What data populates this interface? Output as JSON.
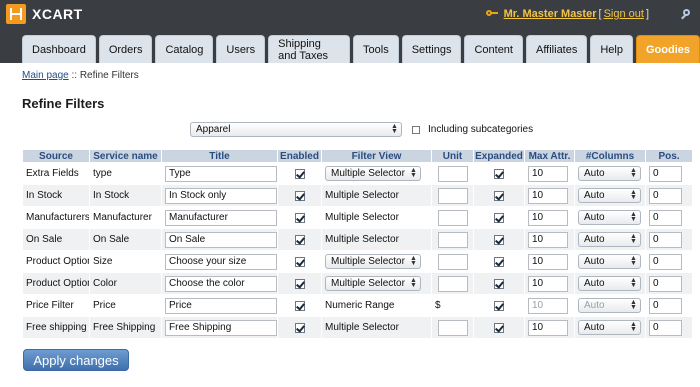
{
  "brand": {
    "name": "XCART"
  },
  "user": {
    "name": "Mr. Master Master",
    "bracket_open": "[",
    "signout": "Sign out",
    "bracket_close": "]"
  },
  "tabs": [
    {
      "label": "Dashboard"
    },
    {
      "label": "Orders"
    },
    {
      "label": "Catalog"
    },
    {
      "label": "Users"
    },
    {
      "label": "Shipping and Taxes"
    },
    {
      "label": "Tools"
    },
    {
      "label": "Settings"
    },
    {
      "label": "Content"
    },
    {
      "label": "Affiliates"
    },
    {
      "label": "Help"
    },
    {
      "label": "Goodies",
      "active": true
    }
  ],
  "breadcrumb": {
    "home": "Main page",
    "sep": " :: ",
    "current": "Refine Filters"
  },
  "page_title": "Refine Filters",
  "category": {
    "selected": "Apparel",
    "include_sub_label": "Including subcategories",
    "include_sub_checked": false
  },
  "table": {
    "headers": [
      "Source",
      "Service name",
      "Title",
      "Enabled",
      "Filter View",
      "Unit",
      "Expanded",
      "Max Attr.",
      "#Columns",
      "Pos."
    ],
    "rows": [
      {
        "source": "Extra Fields",
        "service": "type",
        "title": "Type",
        "enabled": true,
        "filter_view": "Multiple Selector",
        "filter_view_select": true,
        "unit": "",
        "unit_input": true,
        "expanded": true,
        "max": "10",
        "max_dim": false,
        "columns": "Auto",
        "columns_dim": false,
        "pos": "0"
      },
      {
        "source": "In Stock",
        "service": "In Stock",
        "title": "In Stock only",
        "enabled": true,
        "filter_view": "Multiple Selector",
        "filter_view_select": false,
        "unit": "",
        "unit_input": true,
        "expanded": true,
        "max": "10",
        "max_dim": false,
        "columns": "Auto",
        "columns_dim": false,
        "pos": "0"
      },
      {
        "source": "Manufacturers",
        "service": "Manufacturer",
        "title": "Manufacturer",
        "enabled": true,
        "filter_view": "Multiple Selector",
        "filter_view_select": false,
        "unit": "",
        "unit_input": true,
        "expanded": true,
        "max": "10",
        "max_dim": false,
        "columns": "Auto",
        "columns_dim": false,
        "pos": "0"
      },
      {
        "source": "On Sale",
        "service": "On Sale",
        "title": "On Sale",
        "enabled": true,
        "filter_view": "Multiple Selector",
        "filter_view_select": false,
        "unit": "",
        "unit_input": true,
        "expanded": true,
        "max": "10",
        "max_dim": false,
        "columns": "Auto",
        "columns_dim": false,
        "pos": "0"
      },
      {
        "source": "Product Option",
        "service": "Size",
        "title": "Choose your size",
        "enabled": true,
        "filter_view": "Multiple Selector",
        "filter_view_select": true,
        "unit": "",
        "unit_input": true,
        "expanded": true,
        "max": "10",
        "max_dim": false,
        "columns": "Auto",
        "columns_dim": false,
        "pos": "0"
      },
      {
        "source": "Product Option",
        "service": "Color",
        "title": "Choose the color",
        "enabled": true,
        "filter_view": "Multiple Selector",
        "filter_view_select": true,
        "unit": "",
        "unit_input": true,
        "expanded": true,
        "max": "10",
        "max_dim": false,
        "columns": "Auto",
        "columns_dim": false,
        "pos": "0"
      },
      {
        "source": "Price Filter",
        "service": "Price",
        "title": "Price",
        "enabled": true,
        "filter_view": "Numeric Range",
        "filter_view_select": false,
        "unit": "$",
        "unit_input": false,
        "expanded": true,
        "max": "10",
        "max_dim": true,
        "columns": "Auto",
        "columns_dim": true,
        "pos": "0"
      },
      {
        "source": "Free shipping",
        "service": "Free Shipping",
        "title": "Free Shipping",
        "enabled": true,
        "filter_view": "Multiple Selector",
        "filter_view_select": false,
        "unit": "",
        "unit_input": true,
        "expanded": true,
        "max": "10",
        "max_dim": false,
        "columns": "Auto",
        "columns_dim": false,
        "pos": "0"
      }
    ]
  },
  "apply_button": "Apply changes",
  "colors": {
    "header_bg": "#3a3d42",
    "active_tab": "#f1a32a",
    "link": "#1f4e87",
    "table_header_bg": "#cbd5e1",
    "button": "#4f7fbd"
  }
}
